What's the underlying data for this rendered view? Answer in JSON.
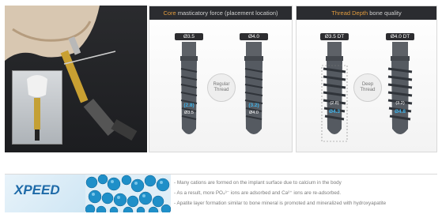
{
  "panel_core": {
    "header_accent": "Core",
    "header_rest": "masticatory force (placement location)",
    "implants": [
      {
        "size": "Ø3.5",
        "value": "(2.8)",
        "sub": "Ø3.5"
      },
      {
        "size": "Ø4.0",
        "value": "(3.2)",
        "sub": "Ø4.0"
      }
    ],
    "badge": "Regular Thread"
  },
  "panel_thread": {
    "header_accent": "Thread Depth",
    "header_rest": "bone quality",
    "implants": [
      {
        "size": "Ø3.5 DT",
        "value": "(2.8)",
        "sub": "Ø4.3"
      },
      {
        "size": "Ø4.0 DT",
        "value": "(3.2)",
        "sub": "Ø4.8"
      }
    ],
    "badge": "Deep Thread"
  },
  "banner": {
    "logo": "XPEED",
    "bullets": [
      "- Many cations are formed on the implant surface due to calcium in the body",
      "- As a result, more PO₄³⁻ ions are adsorbed and Ca²⁺ ions are re-adsorbed.",
      "- Apatite layer formation similar to bone mineral is promoted and mineralized with hydroxyapatite"
    ]
  },
  "colors": {
    "accent": "#e09b3e",
    "core_blue": "#3fb3ea"
  }
}
